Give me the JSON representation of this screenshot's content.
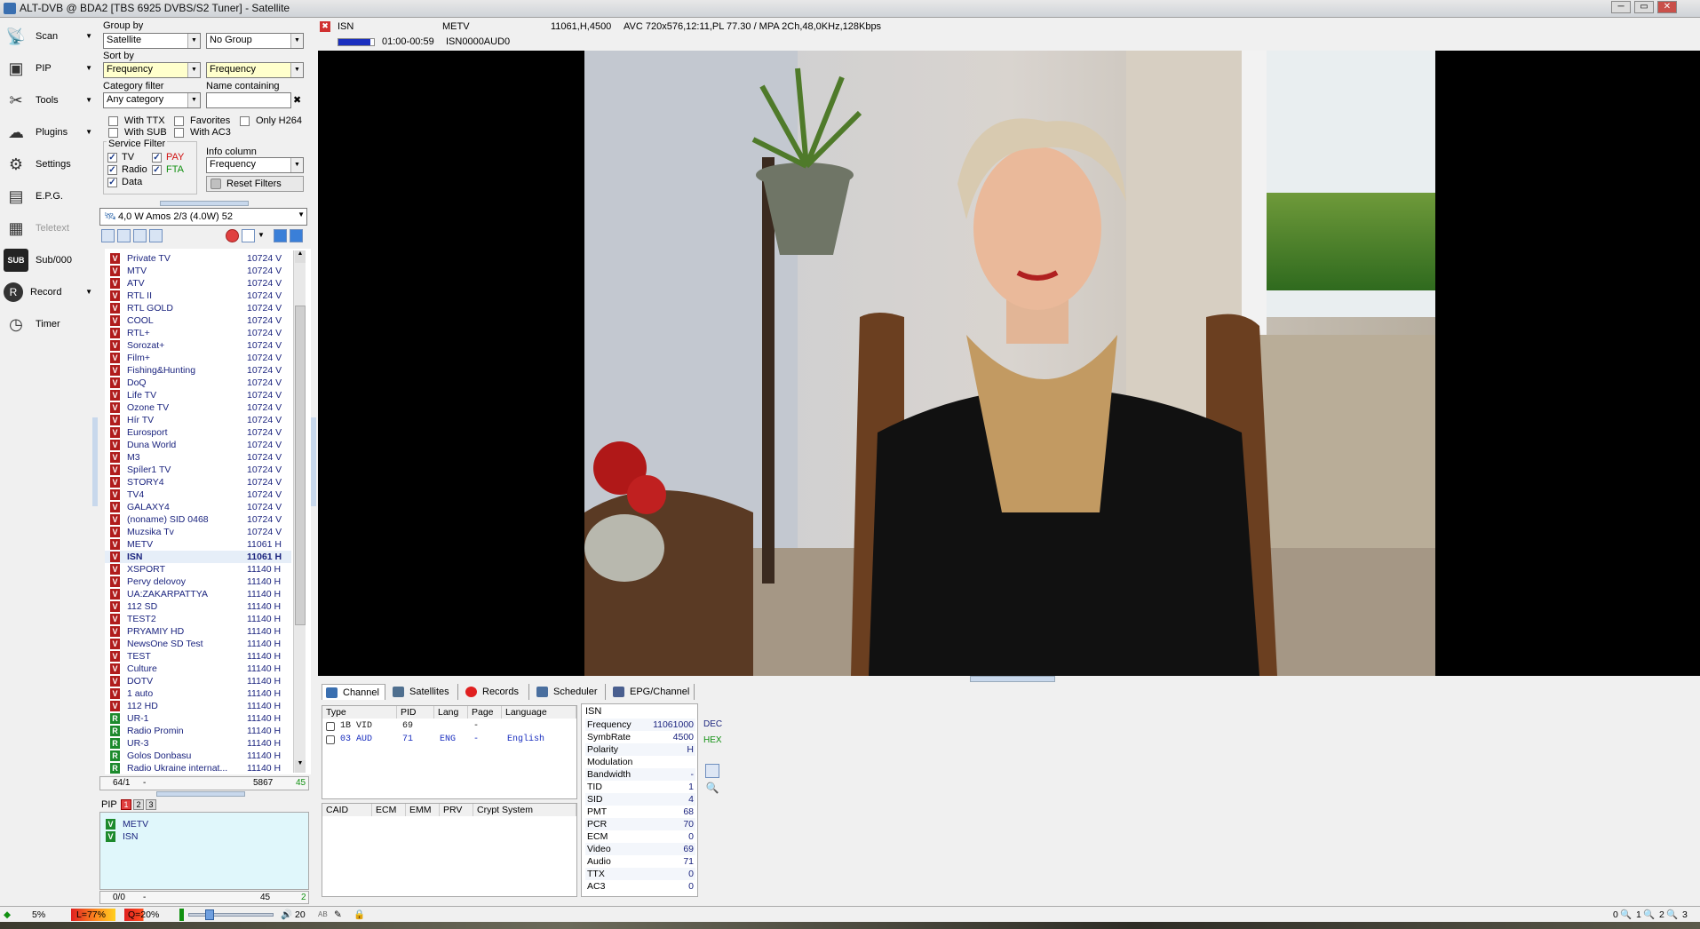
{
  "window": {
    "title": "ALT-DVB @ BDA2 [TBS 6925 DVBS/S2 Tuner] - Satellite",
    "min": "─",
    "max": "▭",
    "close": "✕"
  },
  "leftbar": [
    {
      "label": "Scan",
      "icon": "satellite-dish-icon",
      "glyph": "📡",
      "arrow": true
    },
    {
      "label": "PIP",
      "icon": "pip-icon",
      "glyph": "▣",
      "arrow": true
    },
    {
      "label": "Tools",
      "icon": "tools-icon",
      "glyph": "✂",
      "arrow": true
    },
    {
      "label": "Plugins",
      "icon": "plugins-icon",
      "glyph": "☁",
      "arrow": true
    },
    {
      "label": "Settings",
      "icon": "settings-gear-icon",
      "glyph": "⚙",
      "arrow": false
    },
    {
      "label": "E.P.G.",
      "icon": "epg-film-icon",
      "glyph": "▤",
      "arrow": false
    },
    {
      "label": "Teletext",
      "icon": "teletext-icon",
      "glyph": "▦",
      "arrow": false
    },
    {
      "label": "Sub/000",
      "icon": "subtitles-icon",
      "glyph": "SUB",
      "arrow": false
    },
    {
      "label": "Record",
      "icon": "record-icon",
      "glyph": "R",
      "arrow": true
    },
    {
      "label": "Timer",
      "icon": "timer-clock-icon",
      "glyph": "◷",
      "arrow": false
    }
  ],
  "filters": {
    "group_by_label": "Group by",
    "group_by_value": "Satellite",
    "group_value": "No Group",
    "sort_by_label": "Sort by",
    "sort_value1": "Frequency",
    "sort_value2": "Frequency",
    "category_label": "Category filter",
    "category_value": "Any category",
    "name_label": "Name containing",
    "name_value": "",
    "with_ttx": "With TTX",
    "favorites": "Favorites",
    "only_h264": "Only H264",
    "with_sub": "With SUB",
    "with_ac3": "With AC3",
    "service_filter_label": "Service Filter",
    "tv": "TV",
    "pay": "PAY",
    "radio": "Radio",
    "fta": "FTA",
    "data": "Data",
    "info_column_label": "Info column",
    "info_column_value": "Frequency",
    "reset": "Reset Filters"
  },
  "satellite_select": "4,0 W Amos 2/3 (4.0W)  52",
  "channels": [
    {
      "type": "V",
      "name": "Private TV",
      "freq": "10724 V"
    },
    {
      "type": "V",
      "name": "MTV",
      "freq": "10724 V"
    },
    {
      "type": "V",
      "name": "ATV",
      "freq": "10724 V"
    },
    {
      "type": "V",
      "name": "RTL II",
      "freq": "10724 V"
    },
    {
      "type": "V",
      "name": "RTL GOLD",
      "freq": "10724 V"
    },
    {
      "type": "V",
      "name": "COOL",
      "freq": "10724 V"
    },
    {
      "type": "V",
      "name": "RTL+",
      "freq": "10724 V"
    },
    {
      "type": "V",
      "name": "Sorozat+",
      "freq": "10724 V"
    },
    {
      "type": "V",
      "name": "Film+",
      "freq": "10724 V"
    },
    {
      "type": "V",
      "name": "Fishing&Hunting",
      "freq": "10724 V"
    },
    {
      "type": "V",
      "name": "DoQ",
      "freq": "10724 V"
    },
    {
      "type": "V",
      "name": "Life TV",
      "freq": "10724 V"
    },
    {
      "type": "V",
      "name": "Ozone TV",
      "freq": "10724 V"
    },
    {
      "type": "V",
      "name": "Hír TV",
      "freq": "10724 V"
    },
    {
      "type": "V",
      "name": "Eurosport",
      "freq": "10724 V"
    },
    {
      "type": "V",
      "name": "Duna World",
      "freq": "10724 V"
    },
    {
      "type": "V",
      "name": "M3",
      "freq": "10724 V"
    },
    {
      "type": "V",
      "name": "Spíler1 TV",
      "freq": "10724 V"
    },
    {
      "type": "V",
      "name": "STORY4",
      "freq": "10724 V"
    },
    {
      "type": "V",
      "name": "TV4",
      "freq": "10724 V"
    },
    {
      "type": "V",
      "name": "GALAXY4",
      "freq": "10724 V"
    },
    {
      "type": "V",
      "name": "(noname) SID 0468",
      "freq": "10724 V"
    },
    {
      "type": "V",
      "name": "Muzsika Tv",
      "freq": "10724 V"
    },
    {
      "type": "V",
      "name": "METV",
      "freq": "11061 H"
    },
    {
      "type": "V",
      "name": "ISN",
      "freq": "11061 H",
      "selected": true
    },
    {
      "type": "V",
      "name": "XSPORT",
      "freq": "11140 H"
    },
    {
      "type": "V",
      "name": "Pervy delovoy",
      "freq": "11140 H"
    },
    {
      "type": "V",
      "name": "UA:ZAKARPATTYA",
      "freq": "11140 H"
    },
    {
      "type": "V",
      "name": "112 SD",
      "freq": "11140 H"
    },
    {
      "type": "V",
      "name": "TEST2",
      "freq": "11140 H"
    },
    {
      "type": "V",
      "name": "PRYAMIY HD",
      "freq": "11140 H"
    },
    {
      "type": "V",
      "name": "NewsOne SD Test",
      "freq": "11140 H"
    },
    {
      "type": "V",
      "name": "TEST",
      "freq": "11140 H"
    },
    {
      "type": "V",
      "name": "Culture",
      "freq": "11140 H"
    },
    {
      "type": "V",
      "name": "DOTV",
      "freq": "11140 H"
    },
    {
      "type": "V",
      "name": "1 auto",
      "freq": "11140 H"
    },
    {
      "type": "V",
      "name": "112 HD",
      "freq": "11140 H"
    },
    {
      "type": "R",
      "name": "UR-1",
      "freq": "11140 H"
    },
    {
      "type": "R",
      "name": "Radio Promin",
      "freq": "11140 H"
    },
    {
      "type": "R",
      "name": "UR-3",
      "freq": "11140 H"
    },
    {
      "type": "R",
      "name": "Golos Donbasu",
      "freq": "11140 H"
    },
    {
      "type": "R",
      "name": "Radio Ukraine internat...",
      "freq": "11140 H"
    }
  ],
  "list_status": {
    "pos": "64/1",
    "dash": "-",
    "count": "5867",
    "num": "45"
  },
  "pip": {
    "label": "PIP",
    "t1": "1",
    "t2": "2",
    "t3": "3",
    "items": [
      "METV",
      "ISN"
    ]
  },
  "pip_status": {
    "pos": "0/0",
    "dash": "-",
    "count": "45",
    "num": "2"
  },
  "infobar": {
    "name": "ISN",
    "provider": "METV",
    "tp": "11061,H,4500",
    "stream": "AVC 720x576,12:11,PL 77.30 / MPA 2Ch,48,0KHz,128Kbps",
    "time": "01:00-00:59",
    "pid_info": "ISN0000AUD0",
    "progress": 0.9
  },
  "tabs": [
    {
      "label": "Channel",
      "icon": "channel-icon",
      "color": "#3a6fb0"
    },
    {
      "label": "Satellites",
      "icon": "satellite-icon",
      "color": "#4f6f8f"
    },
    {
      "label": "Records",
      "icon": "record-red-icon",
      "color": "#e02020"
    },
    {
      "label": "Scheduler",
      "icon": "scheduler-grid-icon",
      "color": "#4a6f9f"
    },
    {
      "label": "EPG/Channel",
      "icon": "epg-channel-icon",
      "color": "#4a5f8f"
    }
  ],
  "pid_table": {
    "headers": [
      "Type",
      "PID",
      "Lang",
      "Page",
      "Language"
    ],
    "rows": [
      {
        "type": "1B VID",
        "pid": "69",
        "lang": "",
        "page": "-",
        "language": "",
        "color": "#1a1a1a"
      },
      {
        "type": "03 AUD",
        "pid": "71",
        "lang": "ENG",
        "page": "-",
        "language": "English",
        "color": "#1a2fbf"
      }
    ]
  },
  "caid_table": {
    "headers": [
      "CAID",
      "ECM",
      "EMM",
      "PRV",
      "Crypt System"
    ]
  },
  "channel_info": {
    "title": "ISN",
    "rows": [
      {
        "k": "Frequency",
        "v": "11061000"
      },
      {
        "k": "SymbRate",
        "v": "4500"
      },
      {
        "k": "Polarity",
        "v": "H"
      },
      {
        "k": "Modulation",
        "v": ""
      },
      {
        "k": "Bandwidth",
        "v": "-"
      },
      {
        "k": "TID",
        "v": "1"
      },
      {
        "k": "SID",
        "v": "4"
      },
      {
        "k": "PMT",
        "v": "68"
      },
      {
        "k": "PCR",
        "v": "70"
      },
      {
        "k": "ECM",
        "v": "0"
      },
      {
        "k": "Video",
        "v": "69"
      },
      {
        "k": "Audio",
        "v": "71"
      },
      {
        "k": "TTX",
        "v": "0"
      },
      {
        "k": "AC3",
        "v": "0"
      }
    ],
    "dec": "DEC",
    "hex": "HEX"
  },
  "statusbar": {
    "signal": "5%",
    "level": "L=77%",
    "quality": "Q=20%",
    "volume": "20",
    "ab": "AB",
    "zoom0": "0",
    "zoom1": "1",
    "zoom2": "2",
    "zoom3": "3"
  }
}
